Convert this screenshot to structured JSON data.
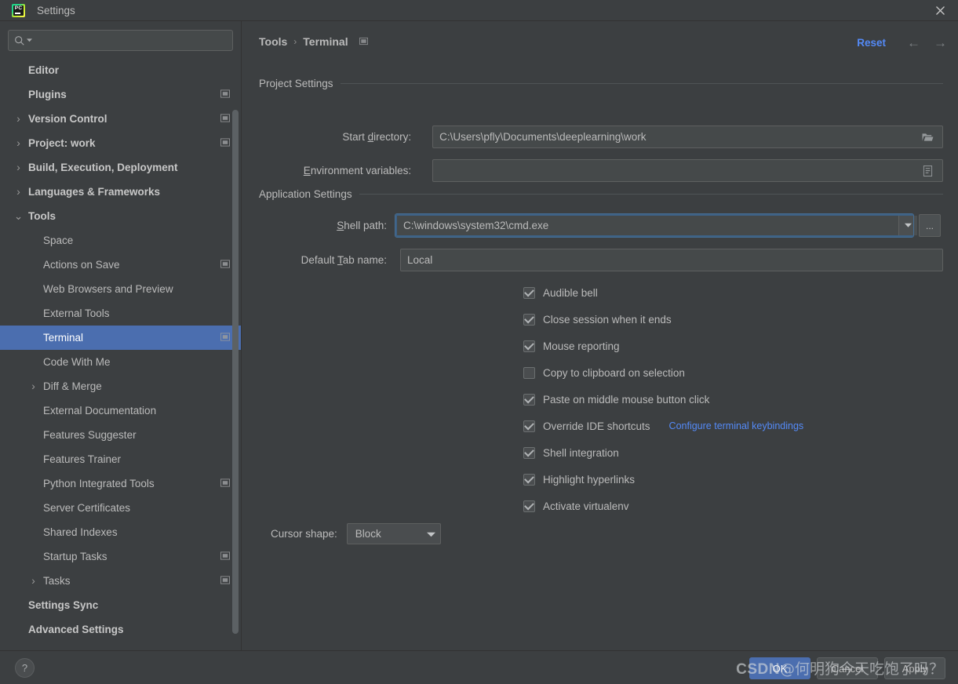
{
  "window": {
    "title": "Settings",
    "logo_text": "PC",
    "close_label": "✕"
  },
  "sidebar": {
    "search": {
      "value": "",
      "placeholder": ""
    },
    "items": [
      {
        "label": "Editor",
        "depth": 0,
        "bold": true,
        "arrow": "",
        "badge": false,
        "selected": false
      },
      {
        "label": "Plugins",
        "depth": 0,
        "bold": true,
        "arrow": "",
        "badge": true,
        "selected": false
      },
      {
        "label": "Version Control",
        "depth": 0,
        "bold": true,
        "arrow": "›",
        "badge": true,
        "selected": false
      },
      {
        "label": "Project: work",
        "depth": 0,
        "bold": true,
        "arrow": "›",
        "badge": true,
        "selected": false
      },
      {
        "label": "Build, Execution, Deployment",
        "depth": 0,
        "bold": true,
        "arrow": "›",
        "badge": false,
        "selected": false
      },
      {
        "label": "Languages & Frameworks",
        "depth": 0,
        "bold": true,
        "arrow": "›",
        "badge": false,
        "selected": false
      },
      {
        "label": "Tools",
        "depth": 0,
        "bold": true,
        "arrow": "⌄",
        "badge": false,
        "selected": false
      },
      {
        "label": "Space",
        "depth": 1,
        "bold": false,
        "arrow": "",
        "badge": false,
        "selected": false
      },
      {
        "label": "Actions on Save",
        "depth": 1,
        "bold": false,
        "arrow": "",
        "badge": true,
        "selected": false
      },
      {
        "label": "Web Browsers and Preview",
        "depth": 1,
        "bold": false,
        "arrow": "",
        "badge": false,
        "selected": false
      },
      {
        "label": "External Tools",
        "depth": 1,
        "bold": false,
        "arrow": "",
        "badge": false,
        "selected": false
      },
      {
        "label": "Terminal",
        "depth": 1,
        "bold": false,
        "arrow": "",
        "badge": true,
        "selected": true
      },
      {
        "label": "Code With Me",
        "depth": 1,
        "bold": false,
        "arrow": "",
        "badge": false,
        "selected": false
      },
      {
        "label": "Diff & Merge",
        "depth": 1,
        "bold": false,
        "arrow": "›",
        "badge": false,
        "selected": false
      },
      {
        "label": "External Documentation",
        "depth": 1,
        "bold": false,
        "arrow": "",
        "badge": false,
        "selected": false
      },
      {
        "label": "Features Suggester",
        "depth": 1,
        "bold": false,
        "arrow": "",
        "badge": false,
        "selected": false
      },
      {
        "label": "Features Trainer",
        "depth": 1,
        "bold": false,
        "arrow": "",
        "badge": false,
        "selected": false
      },
      {
        "label": "Python Integrated Tools",
        "depth": 1,
        "bold": false,
        "arrow": "",
        "badge": true,
        "selected": false
      },
      {
        "label": "Server Certificates",
        "depth": 1,
        "bold": false,
        "arrow": "",
        "badge": false,
        "selected": false
      },
      {
        "label": "Shared Indexes",
        "depth": 1,
        "bold": false,
        "arrow": "",
        "badge": false,
        "selected": false
      },
      {
        "label": "Startup Tasks",
        "depth": 1,
        "bold": false,
        "arrow": "",
        "badge": true,
        "selected": false
      },
      {
        "label": "Tasks",
        "depth": 1,
        "bold": false,
        "arrow": "›",
        "badge": true,
        "selected": false
      },
      {
        "label": "Settings Sync",
        "depth": 0,
        "bold": true,
        "arrow": "",
        "badge": false,
        "selected": false
      },
      {
        "label": "Advanced Settings",
        "depth": 0,
        "bold": true,
        "arrow": "",
        "badge": false,
        "selected": false
      }
    ]
  },
  "main": {
    "breadcrumb": {
      "root": "Tools",
      "separator": "›",
      "current": "Terminal"
    },
    "reset_label": "Reset",
    "back_arrow": "←",
    "forward_arrow": "→",
    "project_settings": {
      "title": "Project Settings",
      "start_directory_label": "Start directory:",
      "start_directory_value": "C:\\Users\\pfly\\Documents\\deeplearning\\work",
      "environment_variables_label": "Environment variables:",
      "environment_variables_value": ""
    },
    "application_settings": {
      "title": "Application Settings",
      "shell_path_label": "Shell path:",
      "shell_path_value": "C:\\windows\\system32\\cmd.exe",
      "shell_path_browse_label": "...",
      "default_tab_name_label": "Default Tab name:",
      "default_tab_name_value": "Local",
      "checkboxes": [
        {
          "label": "Audible bell",
          "checked": true
        },
        {
          "label": "Close session when it ends",
          "checked": true
        },
        {
          "label": "Mouse reporting",
          "checked": true
        },
        {
          "label": "Copy to clipboard on selection",
          "checked": false
        },
        {
          "label": "Paste on middle mouse button click",
          "checked": true
        },
        {
          "label": "Override IDE shortcuts",
          "checked": true,
          "link": "Configure terminal keybindings"
        },
        {
          "label": "Shell integration",
          "checked": true
        },
        {
          "label": "Highlight hyperlinks",
          "checked": true
        },
        {
          "label": "Activate virtualenv",
          "checked": true
        }
      ],
      "cursor_shape_label": "Cursor shape:",
      "cursor_shape_value": "Block"
    }
  },
  "bottom": {
    "help_label": "?",
    "ok_label": "OK",
    "cancel_label": "Cancel",
    "apply_label": "Apply"
  },
  "watermark": {
    "brand": "CSDN",
    "text": "@何明狗今天吃饱了吗？"
  },
  "colors": {
    "background": "#3c3f41",
    "selection": "#4b6eaf",
    "link": "#548af7",
    "field": "#45494a",
    "text": "#bbbbbb"
  }
}
